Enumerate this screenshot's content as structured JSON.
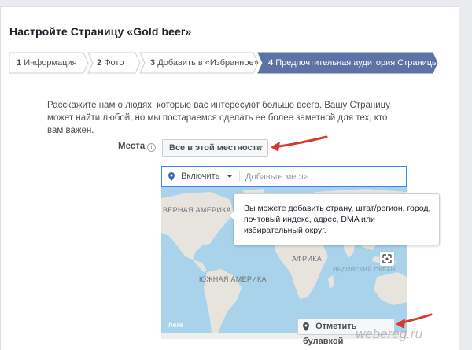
{
  "page": {
    "title": "Настройте Страницу «Gold beer»"
  },
  "steps": [
    {
      "num": "1",
      "label": "Информация",
      "active": false
    },
    {
      "num": "2",
      "label": "Фото",
      "active": false
    },
    {
      "num": "3",
      "label": "Добавить в «Избранное»",
      "active": false
    },
    {
      "num": "4",
      "label": "Предпочтительная аудитория Страницы",
      "active": true
    }
  ],
  "intro_text": "Расскажите нам о людях, которые вас интересуют больше всего. Вашу Страницу может найти любой, но мы постараемся сделать ее более заметной для тех, кто вам важен.",
  "places": {
    "label": "Места",
    "dropdown_value": "Все в этой местности",
    "include_label": "Включить",
    "search_placeholder": "Добавьте места"
  },
  "map": {
    "labels": {
      "north_america": "ВЕРНАЯ АМЕРИКА",
      "africa": "АФРИКА",
      "south_america": "ЮЖНАЯ АМЕРИКА",
      "indian_ocean": "ИНДИЙСКИЙ ОКЕАН"
    },
    "provider_logo": "here",
    "pin_button_label": "Отметить булавкой"
  },
  "tooltip": {
    "text": "Вы можете добавить страну, штат/регион, город, почтовый индекс, адрес, DMA или избирательный округ."
  },
  "watermark": "webereg.ru",
  "colors": {
    "accent_blue": "#4267b2",
    "active_step": "#5d73a6",
    "annotation_arrow": "#d63a2a",
    "ocean": "#a9d3ea",
    "land": "#e6e4dd"
  }
}
